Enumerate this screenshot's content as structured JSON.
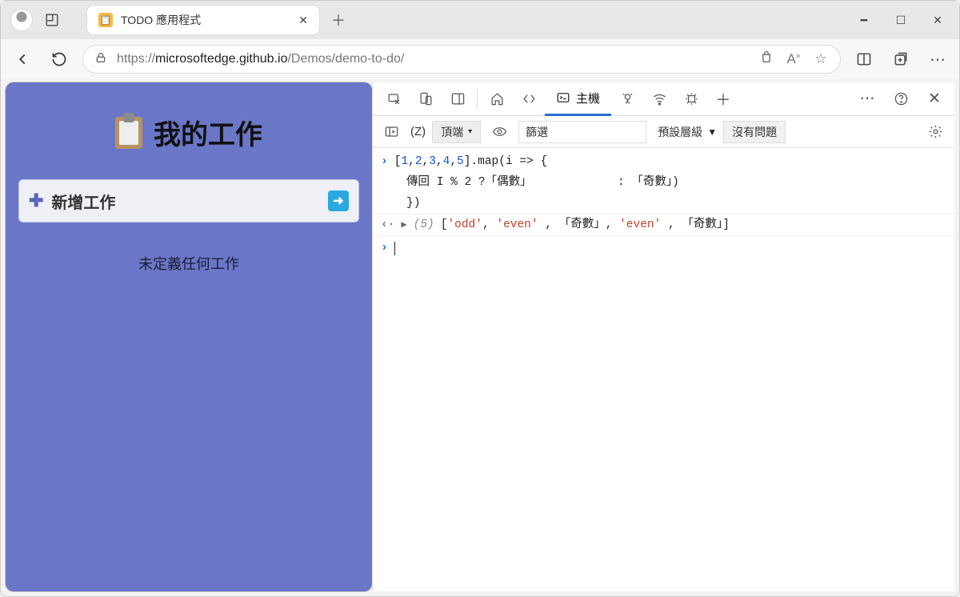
{
  "browser": {
    "tab_title": "TODO 應用程式",
    "url_prefix": "https://",
    "url_host": "microsoftedge.github.io",
    "url_path": "/Demos/demo-to-do/"
  },
  "page": {
    "title": "我的工作",
    "add_label": "新增工作",
    "empty_msg": "未定義任何工作"
  },
  "devtools": {
    "console_tab": "主機",
    "context_z": "(Z)",
    "context_top": "頂端",
    "filter_label": "篩選",
    "levels_label": "預設層級",
    "no_issues_label": "沒有問題"
  },
  "console": {
    "input_line1_a": "[",
    "input_nums": [
      "1",
      "2",
      "3",
      "4",
      "5"
    ],
    "input_line1_b": "].map(i => {",
    "input_line2": "傳回 I % 2 ?「偶數」",
    "input_line2_b": " : 「奇數」)",
    "input_line3": "})",
    "result_count": "(5)",
    "result_items": "['odd', 'even', 「奇數」, 'even', 「奇數」]"
  }
}
